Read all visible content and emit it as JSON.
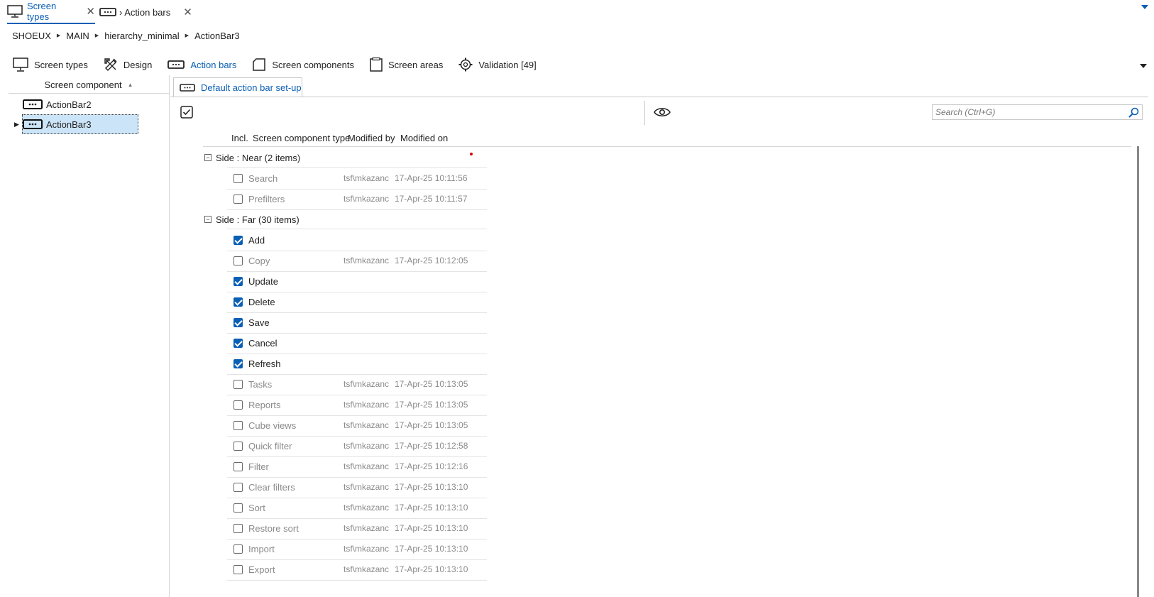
{
  "doc_tabs": [
    {
      "label": "Screen types",
      "icon": "monitor-icon",
      "active": true
    },
    {
      "label": "› Action bars",
      "icon": "action-bar-icon",
      "active": false
    }
  ],
  "breadcrumb": [
    "SHOEUX",
    "MAIN",
    "hierarchy_minimal",
    "ActionBar3"
  ],
  "nav": [
    {
      "label": "Screen types",
      "icon": "monitor-icon"
    },
    {
      "label": "Design",
      "icon": "design-tools-icon"
    },
    {
      "label": "Action bars",
      "icon": "action-bar-icon",
      "active": true
    },
    {
      "label": "Screen components",
      "icon": "screen-component-icon"
    },
    {
      "label": "Screen areas",
      "icon": "screen-area-icon"
    },
    {
      "label": "Validation [49]",
      "icon": "validation-gear-icon"
    }
  ],
  "left_panel": {
    "header": "Screen component",
    "items": [
      {
        "label": "ActionBar2",
        "selected": false
      },
      {
        "label": "ActionBar3",
        "selected": true
      }
    ]
  },
  "content_tab": {
    "label": "Default action bar set-up"
  },
  "search": {
    "placeholder": "Search (Ctrl+G)"
  },
  "grid": {
    "columns": [
      "Incl.",
      "Screen component type",
      "Modified by",
      "Modified on"
    ],
    "groups": [
      {
        "label": "Side : Near (2 items)",
        "rows": [
          {
            "name": "Search",
            "included": false,
            "by": "tsf\\mkazanc",
            "on": "17-Apr-25 10:11:56"
          },
          {
            "name": "Prefilters",
            "included": false,
            "by": "tsf\\mkazanc",
            "on": "17-Apr-25 10:11:57"
          }
        ]
      },
      {
        "label": "Side : Far (30 items)",
        "rows": [
          {
            "name": "Add",
            "included": true,
            "by": "",
            "on": ""
          },
          {
            "name": "Copy",
            "included": false,
            "by": "tsf\\mkazanc",
            "on": "17-Apr-25 10:12:05"
          },
          {
            "name": "Update",
            "included": true,
            "by": "",
            "on": ""
          },
          {
            "name": "Delete",
            "included": true,
            "by": "",
            "on": ""
          },
          {
            "name": "Save",
            "included": true,
            "by": "",
            "on": ""
          },
          {
            "name": "Cancel",
            "included": true,
            "by": "",
            "on": ""
          },
          {
            "name": "Refresh",
            "included": true,
            "by": "",
            "on": ""
          },
          {
            "name": "Tasks",
            "included": false,
            "by": "tsf\\mkazanc",
            "on": "17-Apr-25 10:13:05"
          },
          {
            "name": "Reports",
            "included": false,
            "by": "tsf\\mkazanc",
            "on": "17-Apr-25 10:13:05"
          },
          {
            "name": "Cube views",
            "included": false,
            "by": "tsf\\mkazanc",
            "on": "17-Apr-25 10:13:05"
          },
          {
            "name": "Quick filter",
            "included": false,
            "by": "tsf\\mkazanc",
            "on": "17-Apr-25 10:12:58"
          },
          {
            "name": "Filter",
            "included": false,
            "by": "tsf\\mkazanc",
            "on": "17-Apr-25 10:12:16"
          },
          {
            "name": "Clear filters",
            "included": false,
            "by": "tsf\\mkazanc",
            "on": "17-Apr-25 10:13:10"
          },
          {
            "name": "Sort",
            "included": false,
            "by": "tsf\\mkazanc",
            "on": "17-Apr-25 10:13:10"
          },
          {
            "name": "Restore sort",
            "included": false,
            "by": "tsf\\mkazanc",
            "on": "17-Apr-25 10:13:10"
          },
          {
            "name": "Import",
            "included": false,
            "by": "tsf\\mkazanc",
            "on": "17-Apr-25 10:13:10"
          },
          {
            "name": "Export",
            "included": false,
            "by": "tsf\\mkazanc",
            "on": "17-Apr-25 10:13:10"
          }
        ]
      }
    ]
  },
  "colors": {
    "accent": "#0a5fb4",
    "selection": "#cce4f7",
    "muted_text": "#8a8a8a"
  }
}
